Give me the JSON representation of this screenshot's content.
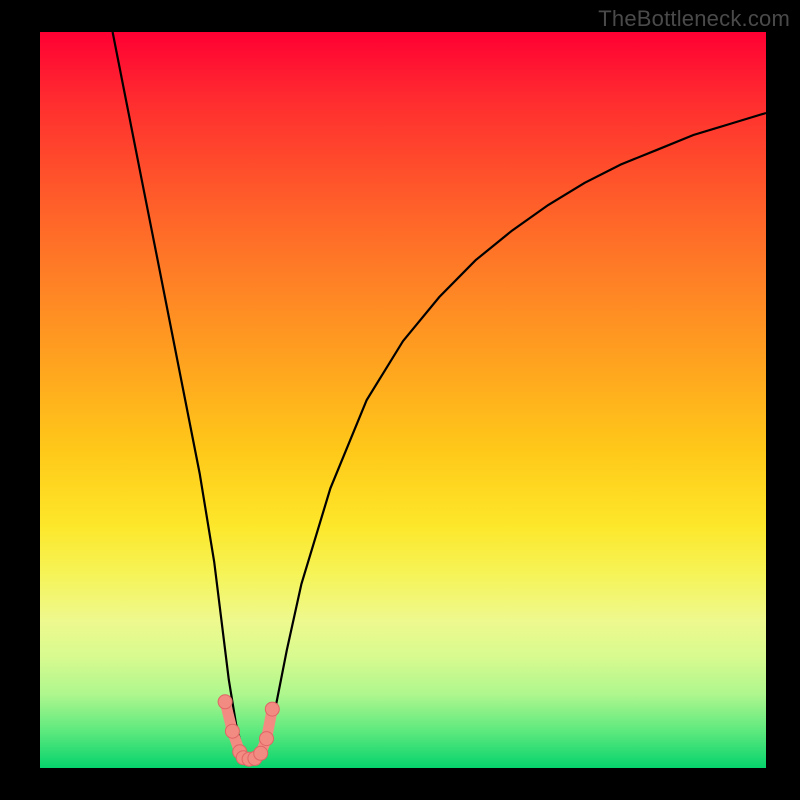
{
  "watermark": "TheBottleneck.com",
  "colors": {
    "curve_stroke": "#000000",
    "marker_fill": "#f28b82",
    "marker_stroke": "#e06666"
  },
  "chart_data": {
    "type": "line",
    "title": "",
    "xlabel": "",
    "ylabel": "",
    "xlim": [
      0,
      100
    ],
    "ylim": [
      0,
      100
    ],
    "series": [
      {
        "name": "bottleneck-curve",
        "x": [
          10,
          12,
          14,
          16,
          18,
          20,
          22,
          24,
          25,
          26,
          27,
          28,
          29,
          30,
          31,
          32,
          34,
          36,
          40,
          45,
          50,
          55,
          60,
          65,
          70,
          75,
          80,
          85,
          90,
          95,
          100
        ],
        "values": [
          100,
          90,
          80,
          70,
          60,
          50,
          40,
          28,
          20,
          12,
          6,
          2,
          1,
          1,
          2,
          6,
          16,
          25,
          38,
          50,
          58,
          64,
          69,
          73,
          76.5,
          79.5,
          82,
          84,
          86,
          87.5,
          89
        ]
      }
    ],
    "markers": {
      "name": "highlight-points",
      "x": [
        25.5,
        26.5,
        27.5,
        28,
        28.8,
        29.6,
        30.4,
        31.2,
        32.0
      ],
      "values": [
        9,
        5,
        2.2,
        1.4,
        1.2,
        1.3,
        2.0,
        4.0,
        8.0
      ]
    }
  }
}
